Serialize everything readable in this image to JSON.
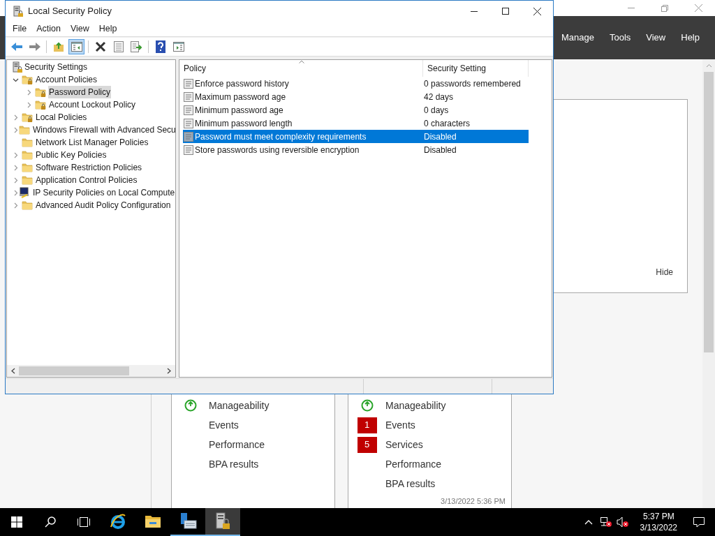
{
  "server_manager": {
    "menu": [
      "Manage",
      "Tools",
      "View",
      "Help"
    ],
    "panel_button": "Hide",
    "tiles": [
      {
        "rows": [
          {
            "label": "Manageability",
            "ok": true
          },
          {
            "label": "Events",
            "ok": false
          },
          {
            "label": "Performance",
            "ok": false
          },
          {
            "label": "BPA results",
            "ok": false
          }
        ]
      },
      {
        "rows": [
          {
            "label": "Manageability",
            "ok": true
          },
          {
            "label": "Events",
            "ok": false,
            "count": "1"
          },
          {
            "label": "Services",
            "ok": false,
            "count": "5"
          },
          {
            "label": "Performance",
            "ok": false
          },
          {
            "label": "BPA results",
            "ok": false
          }
        ],
        "timestamp": "3/13/2022 5:36 PM"
      }
    ]
  },
  "window": {
    "title": "Local Security Policy",
    "menu": [
      "File",
      "Action",
      "View",
      "Help"
    ],
    "toolbar": [
      {
        "kind": "back",
        "pressed": false
      },
      {
        "kind": "forward",
        "pressed": false
      },
      {
        "kind": "sep"
      },
      {
        "kind": "up",
        "pressed": false
      },
      {
        "kind": "tree",
        "pressed": true
      },
      {
        "kind": "sep"
      },
      {
        "kind": "delete",
        "pressed": false
      },
      {
        "kind": "properties",
        "pressed": false
      },
      {
        "kind": "export",
        "pressed": false
      },
      {
        "kind": "sep"
      },
      {
        "kind": "help",
        "pressed": false
      },
      {
        "kind": "pane",
        "pressed": false
      }
    ]
  },
  "tree": {
    "label": "Security Settings",
    "children": [
      {
        "label": "Account Policies",
        "kind": "lock_folder",
        "expandable": true,
        "expanded": true,
        "selected": false,
        "children": [
          {
            "label": "Password Policy",
            "kind": "lock_folder",
            "expandable": true,
            "expanded": false,
            "selected": true
          },
          {
            "label": "Account Lockout Policy",
            "kind": "lock_folder",
            "expandable": true,
            "expanded": false,
            "selected": false
          }
        ]
      },
      {
        "label": "Local Policies",
        "kind": "lock_folder",
        "expandable": true,
        "expanded": false,
        "selected": false
      },
      {
        "label": "Windows Firewall with Advanced Secu",
        "kind": "folder",
        "expandable": true,
        "expanded": false,
        "selected": false
      },
      {
        "label": "Network List Manager Policies",
        "kind": "folder",
        "expandable": false,
        "expanded": false,
        "selected": false
      },
      {
        "label": "Public Key Policies",
        "kind": "folder",
        "expandable": true,
        "expanded": false,
        "selected": false
      },
      {
        "label": "Software Restriction Policies",
        "kind": "folder",
        "expandable": true,
        "expanded": false,
        "selected": false
      },
      {
        "label": "Application Control Policies",
        "kind": "folder",
        "expandable": true,
        "expanded": false,
        "selected": false
      },
      {
        "label": "IP Security Policies on Local Compute",
        "kind": "ipsec",
        "expandable": true,
        "expanded": false,
        "selected": false
      },
      {
        "label": "Advanced Audit Policy Configuration",
        "kind": "folder",
        "expandable": true,
        "expanded": false,
        "selected": false
      }
    ]
  },
  "list": {
    "columns": [
      "Policy",
      "Security Setting"
    ],
    "rows": [
      {
        "policy": "Enforce password history",
        "setting": "0 passwords remembered",
        "selected": false
      },
      {
        "policy": "Maximum password age",
        "setting": "42 days",
        "selected": false
      },
      {
        "policy": "Minimum password age",
        "setting": "0 days",
        "selected": false
      },
      {
        "policy": "Minimum password length",
        "setting": "0 characters",
        "selected": false
      },
      {
        "policy": "Password must meet complexity requirements",
        "setting": "Disabled",
        "selected": true
      },
      {
        "policy": "Store passwords using reversible encryption",
        "setting": "Disabled",
        "selected": false
      }
    ]
  },
  "taskbar": {
    "apps": [
      {
        "kind": "ie",
        "running": false,
        "selected": false
      },
      {
        "kind": "explorer",
        "running": false,
        "selected": false
      },
      {
        "kind": "server_manager",
        "running": true,
        "selected": false
      },
      {
        "kind": "security_policy",
        "running": true,
        "selected": true
      }
    ],
    "time": "5:37 PM",
    "date": "3/13/2022"
  }
}
